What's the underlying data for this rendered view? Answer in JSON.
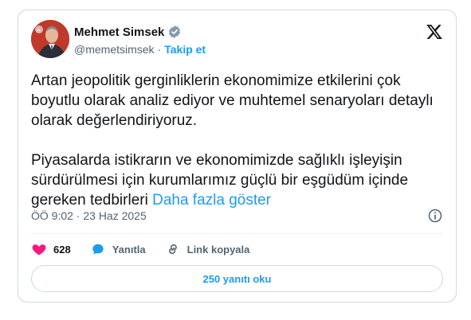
{
  "author": {
    "name": "Mehmet Simsek",
    "handle": "@memetsimsek",
    "separator": "·",
    "follow_label": "Takip et"
  },
  "tweet": {
    "paragraph1": "Artan jeopolitik gerginliklerin ekonomimize etkilerini çok boyutlu olarak analiz ediyor ve muhtemel senaryoları detaylı olarak değerlendiriyoruz.",
    "paragraph2": "Piyasalarda istikrarın ve ekonomimizde sağlıklı işleyişin sürdürülmesi için kurumlarımız güçlü bir eşgüdüm içinde gereken tedbirleri",
    "show_more_label": "Daha fazla göster",
    "timestamp": "ÖÖ 9:02 · 23 Haz 2025"
  },
  "actions": {
    "like_count": "628",
    "reply_label": "Yanıtla",
    "copy_link_label": "Link kopyala"
  },
  "replies_button_label": "250 yanıtı oku",
  "colors": {
    "accent": "#1d9bf0",
    "like": "#f91880",
    "text": "#0f1419",
    "muted": "#536471",
    "border": "#cfd9de"
  },
  "icons": [
    "verified-badge-icon",
    "x-logo-icon",
    "info-icon",
    "heart-icon",
    "reply-bubble-icon",
    "link-icon"
  ]
}
